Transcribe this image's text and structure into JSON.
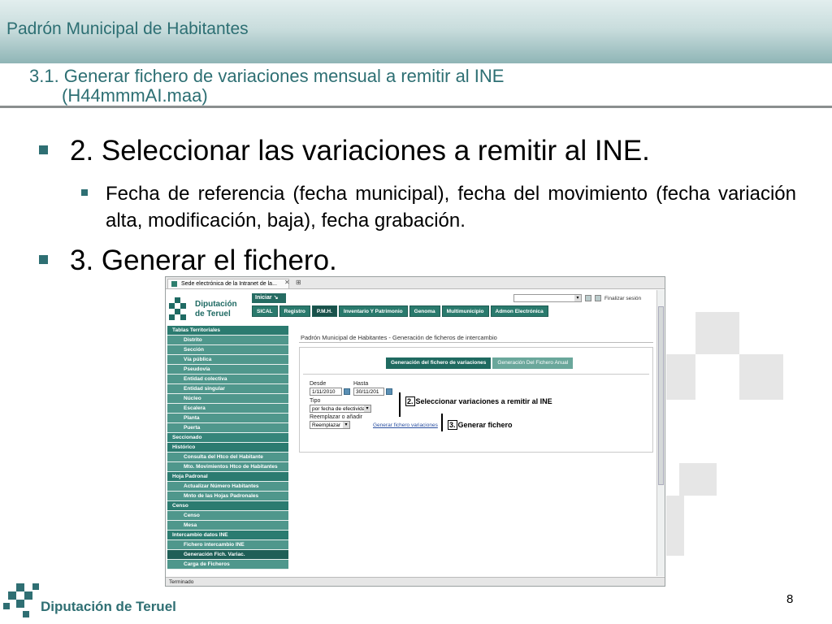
{
  "slide": {
    "app_title": "Padrón Municipal de Habitantes",
    "section_title_line1": "3.1. Generar fichero de variaciones mensual a remitir al INE",
    "section_title_line2": "(H44mmmAI.maa)",
    "bullet1": "2. Seleccionar las variaciones a remitir al INE.",
    "bullet1_sub": "Fecha de referencia (fecha municipal), fecha del movimiento (fecha variación alta, modificación, baja), fecha grabación.",
    "bullet2": "3. Generar el fichero.",
    "footer_name": "Diputación de Teruel",
    "page_number": "8",
    "accent_color": "#2d6f73"
  },
  "browser": {
    "tab_title": "Sede electrónica de la Intranet de la...",
    "status": "Terminado",
    "logo_line1": "Diputación",
    "logo_line2": "de Teruel",
    "iniciar": "Iniciar ↘",
    "finalizar": "Finalizar sesión",
    "top_nav": [
      "SICAL",
      "Registro",
      "P.M.H.",
      "Inventario Y Patrimonio",
      "Genoma",
      "Multimunicipio",
      "Admon Electrónica"
    ],
    "top_nav_active": "P.M.H.",
    "sidebar": [
      {
        "label": "Tablas Territoriales",
        "kind": "sec"
      },
      {
        "label": "Distrito",
        "kind": "item"
      },
      {
        "label": "Sección",
        "kind": "item"
      },
      {
        "label": "Vía pública",
        "kind": "item"
      },
      {
        "label": "Pseudovía",
        "kind": "item"
      },
      {
        "label": "Entidad colectiva",
        "kind": "item"
      },
      {
        "label": "Entidad singular",
        "kind": "item"
      },
      {
        "label": "Núcleo",
        "kind": "item"
      },
      {
        "label": "Escalera",
        "kind": "item"
      },
      {
        "label": "Planta",
        "kind": "item"
      },
      {
        "label": "Puerta",
        "kind": "item"
      },
      {
        "label": "Seccionado",
        "kind": "plain"
      },
      {
        "label": "Histórico",
        "kind": "sec"
      },
      {
        "label": "Consulta del Htco del Habitante",
        "kind": "item"
      },
      {
        "label": "Mto. Movimientos Htco de Habitantes",
        "kind": "item"
      },
      {
        "label": "Hoja Padronal",
        "kind": "sec"
      },
      {
        "label": "Actualizar Número Habitantes",
        "kind": "item"
      },
      {
        "label": "Mnto de las Hojas Padronales",
        "kind": "item"
      },
      {
        "label": "Censo",
        "kind": "sec"
      },
      {
        "label": "Censo",
        "kind": "item"
      },
      {
        "label": "Mesa",
        "kind": "item"
      },
      {
        "label": "Intercambio datos INE",
        "kind": "sec"
      },
      {
        "label": "Fichero intercambio INE",
        "kind": "item"
      },
      {
        "label": "Generación Fich. Variac.",
        "kind": "item",
        "active": true
      },
      {
        "label": "Carga de Ficheros",
        "kind": "item"
      }
    ],
    "main": {
      "title": "Padrón Municipal de Habitantes - Generación de ficheros de intercambio",
      "tab_selected": "Generación del fichero de variaciones",
      "tab_other": "Generación Del Fichero Anual",
      "desde_label": "Desde",
      "desde_value": "1/11/2010",
      "hasta_label": "Hasta",
      "hasta_value": "30/11/201",
      "tipo_label": "Tipo",
      "tipo_value": "por fecha de efectividad",
      "reemplazar_label": "Reemplazar o añadir",
      "reemplazar_value": "Reemplazar",
      "generar_link": "Generar fichero variaciones",
      "step2_num": "2.",
      "step2_text": "Seleccionar variaciones a remitir al INE",
      "step3_num": "3.",
      "step3_text": "Generar fichero"
    }
  }
}
